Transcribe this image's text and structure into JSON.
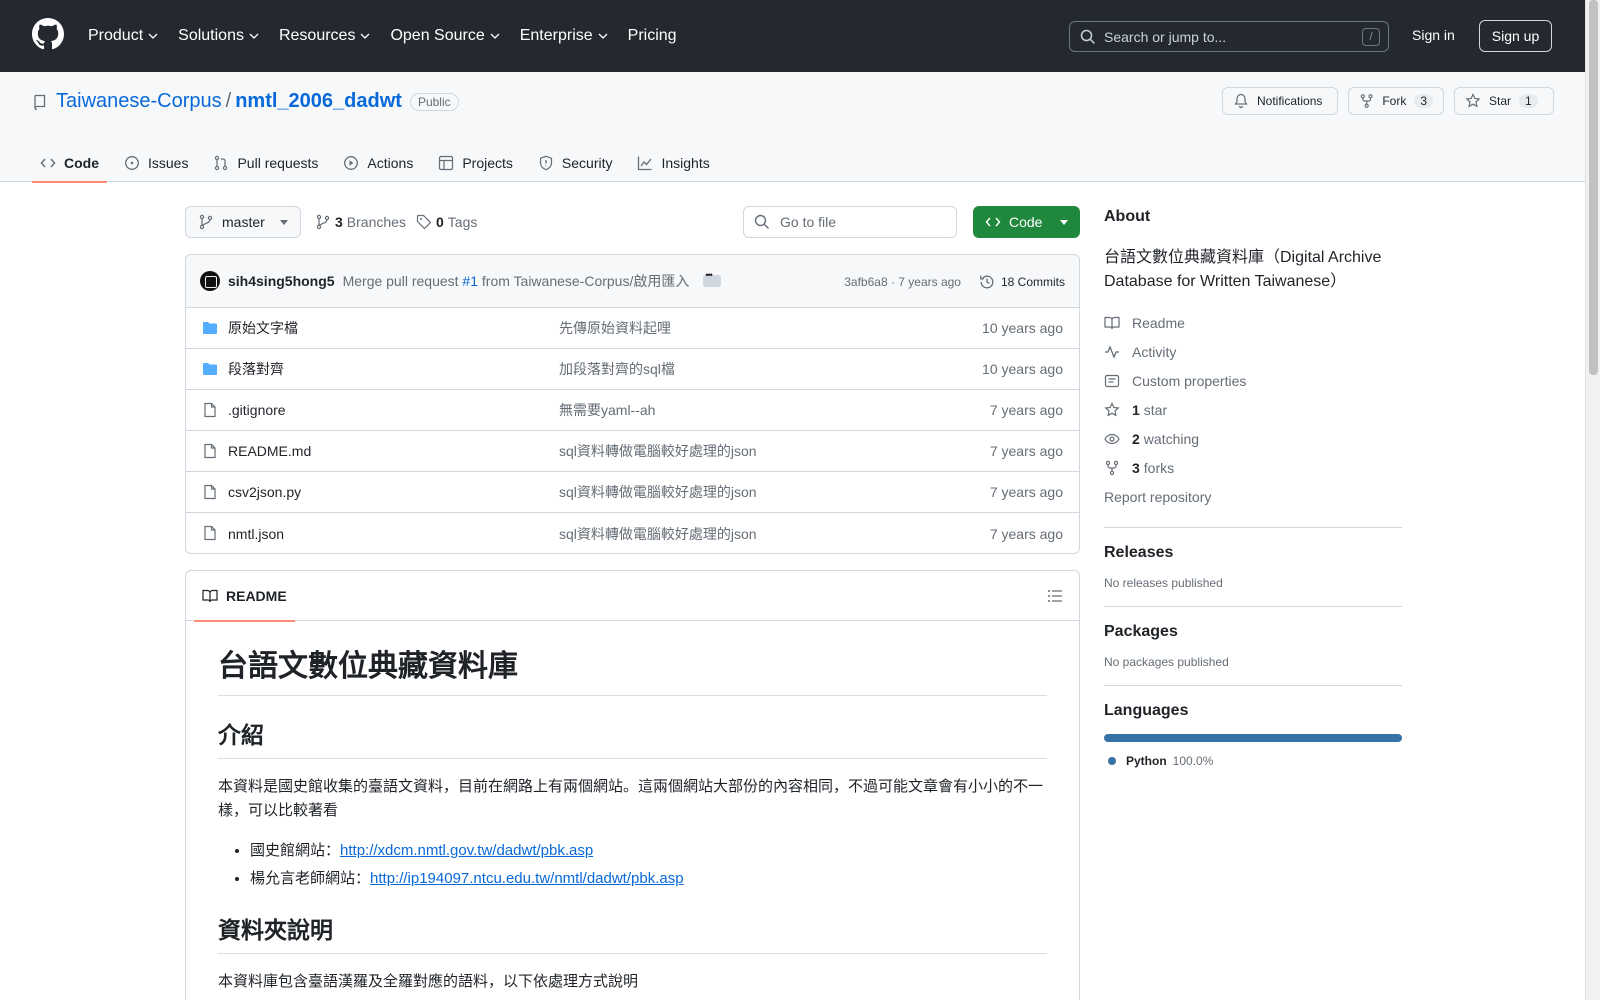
{
  "nav": {
    "items": [
      "Product",
      "Solutions",
      "Resources",
      "Open Source",
      "Enterprise",
      "Pricing"
    ],
    "search_placeholder": "Search or jump to...",
    "search_shortcut": "/",
    "signin": "Sign in",
    "signup": "Sign up"
  },
  "repo": {
    "owner": "Taiwanese-Corpus",
    "separator": "/",
    "name": "nmtl_2006_dadwt",
    "visibility": "Public",
    "notifications": "Notifications",
    "fork_label": "Fork",
    "fork_count": "3",
    "star_label": "Star",
    "star_count": "1"
  },
  "tabs": [
    "Code",
    "Issues",
    "Pull requests",
    "Actions",
    "Projects",
    "Security",
    "Insights"
  ],
  "toolbar": {
    "branch": "master",
    "branches_count": "3",
    "branches_label": "Branches",
    "tags_count": "0",
    "tags_label": "Tags",
    "goto_placeholder": "Go to file",
    "code_label": "Code"
  },
  "commit": {
    "author": "sih4sing5hong5",
    "message_prefix": "Merge pull request",
    "pr": "#1",
    "message_suffix": "from Taiwanese-Corpus/啟用匯入",
    "sha_time": "3afb6a8 · 7 years ago",
    "commits": "18 Commits"
  },
  "files": [
    {
      "name": "原始文字檔",
      "type": "folder",
      "message": "先傳原始資料起哩",
      "time": "10 years ago"
    },
    {
      "name": "段落對齊",
      "type": "folder",
      "message": "加段落對齊的sql檔",
      "time": "10 years ago"
    },
    {
      "name": ".gitignore",
      "type": "file",
      "message": "無需要yaml--ah",
      "time": "7 years ago"
    },
    {
      "name": "README.md",
      "type": "file",
      "message": "sql資料轉做電腦較好處理的json",
      "time": "7 years ago"
    },
    {
      "name": "csv2json.py",
      "type": "file",
      "message": "sql資料轉做電腦較好處理的json",
      "time": "7 years ago"
    },
    {
      "name": "nmtl.json",
      "type": "file",
      "message": "sql資料轉做電腦較好處理的json",
      "time": "7 years ago"
    }
  ],
  "readme": {
    "tab": "README",
    "h1": "台語文數位典藏資料庫",
    "h2_intro": "介紹",
    "intro_text": "本資料是國史館收集的臺語文資料，目前在網路上有兩個網站。這兩個網站大部份的內容相同，不過可能文章會有小小的不一樣，可以比較著看",
    "links": [
      {
        "label": "國史館網站：",
        "url": "http://xdcm.nmtl.gov.tw/dadwt/pbk.asp"
      },
      {
        "label": "楊允言老師網站：",
        "url": "http://ip194097.ntcu.edu.tw/nmtl/dadwt/pbk.asp"
      }
    ],
    "h2_folders": "資料夾說明",
    "folders_text": "本資料庫包含臺語漢羅及全羅對應的語料，以下依處理方式說明"
  },
  "about": {
    "title": "About",
    "description": "台語文數位典藏資料庫（Digital Archive Database for Written Taiwanese）",
    "readme": "Readme",
    "activity": "Activity",
    "custom_properties": "Custom properties",
    "stars_count": "1",
    "stars_label": "star",
    "watching_count": "2",
    "watching_label": "watching",
    "forks_count": "3",
    "forks_label": "forks",
    "report": "Report repository"
  },
  "releases": {
    "title": "Releases",
    "empty": "No releases published"
  },
  "packages": {
    "title": "Packages",
    "empty": "No packages published"
  },
  "languages": {
    "title": "Languages",
    "name": "Python",
    "percent": "100.0%",
    "color": "#3572a5"
  }
}
